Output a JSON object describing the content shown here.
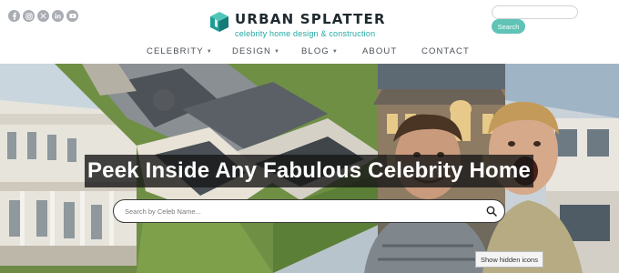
{
  "socials": [
    {
      "name": "facebook"
    },
    {
      "name": "instagram"
    },
    {
      "name": "x"
    },
    {
      "name": "linkedin"
    },
    {
      "name": "youtube"
    }
  ],
  "brand": {
    "title": "URBAN SPLATTER",
    "tagline": "celebrity home design & construction",
    "accent": "#23a8a4",
    "button_color": "#5fc3b6"
  },
  "header_search": {
    "value": "",
    "button_label": "Search"
  },
  "nav": {
    "items": [
      {
        "label": "CELEBRITY",
        "dropdown": true
      },
      {
        "label": "DESIGN",
        "dropdown": true
      },
      {
        "label": "BLOG",
        "dropdown": true
      },
      {
        "label": "ABOUT",
        "dropdown": false
      },
      {
        "label": "CONTACT",
        "dropdown": false
      }
    ]
  },
  "hero": {
    "headline": "Peek Inside Any Fabulous Celebrity Home",
    "search_placeholder": "Search by Celeb Name..."
  },
  "tooltip": {
    "text": "Show hidden icons"
  }
}
